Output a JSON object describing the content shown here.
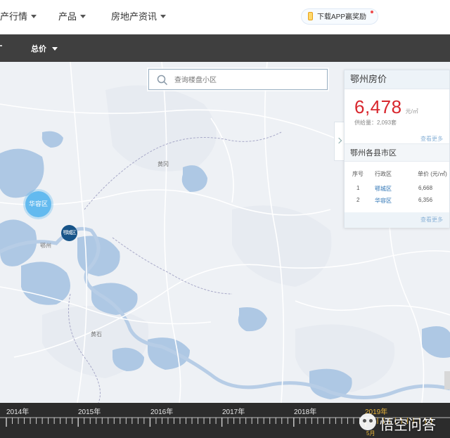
{
  "nav": {
    "items": [
      {
        "label": "产行情"
      },
      {
        "label": "产品"
      },
      {
        "label": "房地产资讯"
      }
    ],
    "app_download": "下载APP赢奖励",
    "accent_color": "#e8a21a"
  },
  "filter": {
    "total_price": "总价"
  },
  "map": {
    "search_placeholder": "查询楼盘小区",
    "labels": {
      "huanggang": "黄冈",
      "ezhou": "鄂州",
      "huangshi": "黄石"
    },
    "bubbles": {
      "huarong": "华容区",
      "echeng": "鄂城区"
    },
    "water_color": "#aec8e4",
    "background_color": "#eef1f5"
  },
  "panel": {
    "title": "鄂州房价",
    "price": "6,478",
    "price_unit": "元/㎡",
    "supply": "供给量：2,093套",
    "more": "查看更多",
    "districts_title": "鄂州各县市区",
    "table": {
      "headers": [
        "序号",
        "行政区",
        "单价 (元/㎡)"
      ],
      "rows": [
        [
          "1",
          "鄂城区",
          "6,668"
        ],
        [
          "2",
          "华容区",
          "6,356"
        ]
      ]
    },
    "more_bottom": "查看更多",
    "price_color": "#d8262d"
  },
  "timeline": {
    "years": [
      "2014年",
      "2015年",
      "2016年",
      "2017年",
      "2018年",
      "2019年"
    ],
    "active_year": "2019年",
    "active_month": "5月",
    "active_color": "#e8b53c"
  },
  "watermark": {
    "text": "悟空问答"
  }
}
